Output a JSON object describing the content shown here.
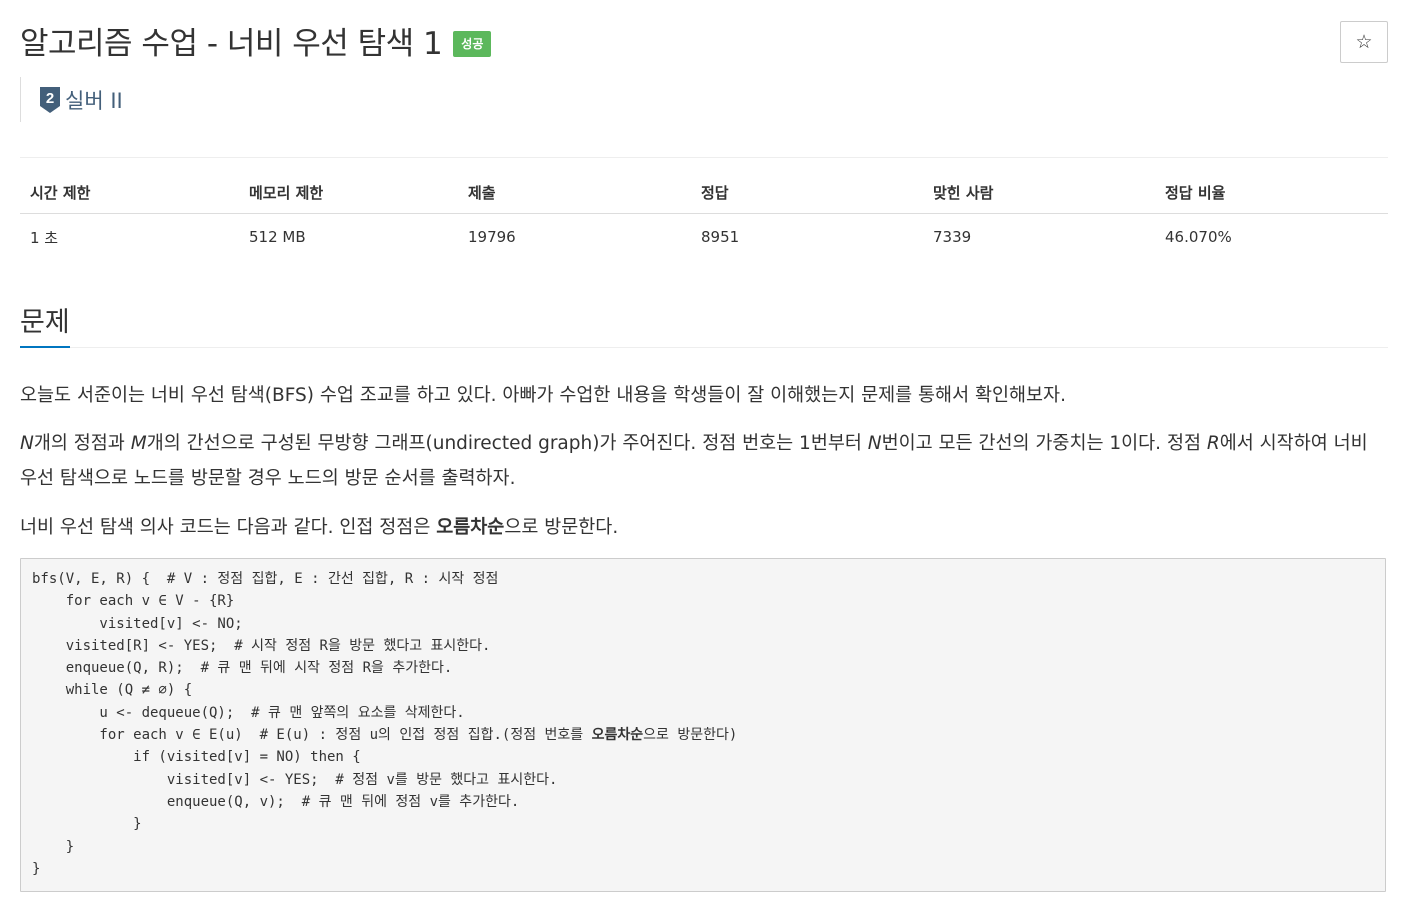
{
  "header": {
    "title": "알고리즘 수업 - 너비 우선 탐색 1",
    "status_badge": "성공",
    "star_icon": "☆",
    "tier": {
      "level": "2",
      "label": "실버 II",
      "icon": "silver-tier-icon",
      "color": "#435f7a"
    }
  },
  "info_table": {
    "headers": [
      "시간 제한",
      "메모리 제한",
      "제출",
      "정답",
      "맞힌 사람",
      "정답 비율"
    ],
    "values": [
      "1 초",
      "512 MB",
      "19796",
      "8951",
      "7339",
      "46.070%"
    ]
  },
  "problem": {
    "section_title": "문제",
    "p1": "오늘도 서준이는 너비 우선 탐색(BFS) 수업 조교를 하고 있다. 아빠가 수업한 내용을 학생들이 잘 이해했는지 문제를 통해서 확인해보자.",
    "p2": {
      "N": "N",
      "t1": "개의 정점과 ",
      "M": "M",
      "t2": "개의 간선으로 구성된 무방향 그래프(undirected graph)가 주어진다. 정점 번호는 1번부터 ",
      "N2": "N",
      "t3": "번이고 모든 간선의 가중치는 1이다. 정점 ",
      "R": "R",
      "t4": "에서 시작하여 너비 우선 탐색으로 노드를 방문할 경우 노드의 방문 순서를 출력하자."
    },
    "p3": {
      "t1": "너비 우선 탐색 의사 코드는 다음과 같다. 인접 정점은 ",
      "bold": "오름차순",
      "t2": "으로 방문한다."
    },
    "code_lines": [
      "bfs(V, E, R) {  # V : 정점 집합, E : 간선 집합, R : 시작 정점",
      "    for each v ∈ V - {R}",
      "        visited[v] <- NO;",
      "    visited[R] <- YES;  # 시작 정점 R을 방문 했다고 표시한다.",
      "    enqueue(Q, R);  # 큐 맨 뒤에 시작 정점 R을 추가한다.",
      "    while (Q ≠ ∅) {",
      "        u <- dequeue(Q);  # 큐 맨 앞쪽의 요소를 삭제한다.",
      "        for each v ∈ E(u)  # E(u) : 정점 u의 인접 정점 집합.(정점 번호를 ",
      "            if (visited[v] = NO) then {",
      "                visited[v] <- YES;  # 정점 v를 방문 했다고 표시한다.",
      "                enqueue(Q, v);  # 큐 맨 뒤에 정점 v를 추가한다.",
      "            }",
      "    }",
      "}"
    ],
    "code_line8_bold": "오름차순",
    "code_line8_tail": "으로 방문한다)"
  }
}
